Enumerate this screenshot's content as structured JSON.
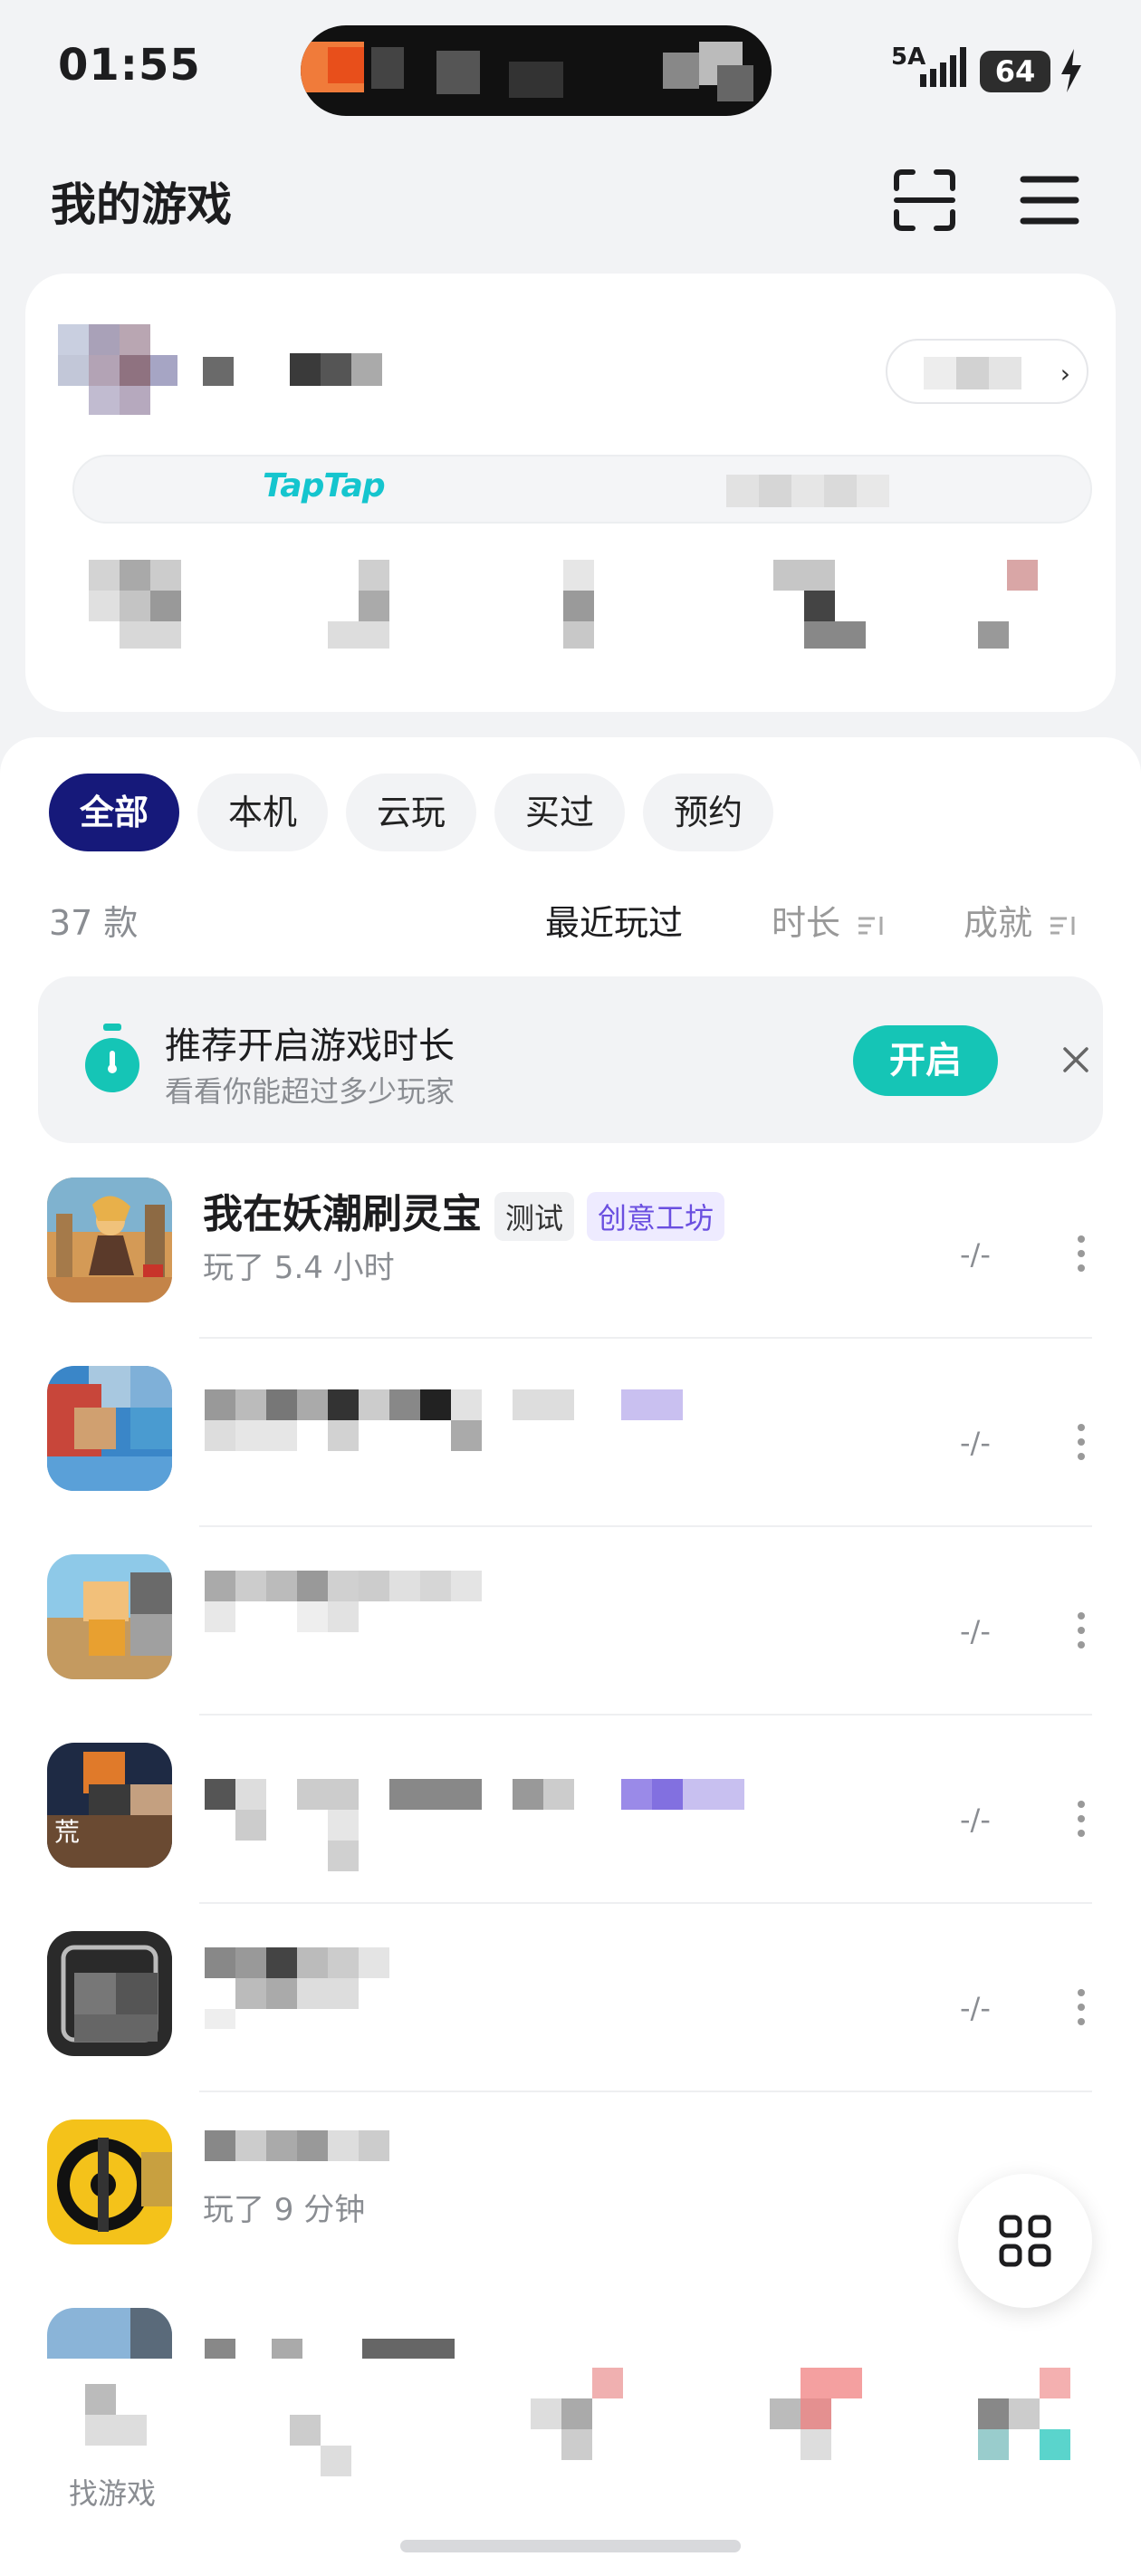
{
  "status_bar": {
    "time": "01:55",
    "signal_label": "5A",
    "battery": "64"
  },
  "header": {
    "title": "我的游戏",
    "scan_icon": "scan-icon",
    "menu_icon": "menu-icon"
  },
  "profile": {
    "platform_logo": "TapTap"
  },
  "tabs": [
    {
      "label": "全部",
      "active": true
    },
    {
      "label": "本机",
      "active": false
    },
    {
      "label": "云玩",
      "active": false
    },
    {
      "label": "买过",
      "active": false
    },
    {
      "label": "预约",
      "active": false
    }
  ],
  "list_header": {
    "count": "37 款",
    "sort_recent": "最近玩过",
    "sort_duration": "时长",
    "sort_achievement": "成就"
  },
  "promo": {
    "title": "推荐开启游戏时长",
    "subtitle": "看看你能超过多少玩家",
    "button": "开启"
  },
  "games": [
    {
      "name": "我在妖潮刷灵宝",
      "tag_test": "测试",
      "tag_workshop": "创意工坊",
      "playtime": "玩了 5.4 小时",
      "score": "-/-"
    },
    {
      "name": "",
      "playtime": "",
      "score": "-/-"
    },
    {
      "name": "",
      "playtime": "",
      "score": "-/-"
    },
    {
      "name": "",
      "playtime": "",
      "score": "-/-"
    },
    {
      "name": "",
      "playtime": "",
      "score": "-/-"
    },
    {
      "name": "",
      "playtime": "玩了 9 分钟",
      "score": ""
    }
  ],
  "bottom_nav": {
    "find_games": "找游戏"
  },
  "colors": {
    "active_tab": "#16197a",
    "accent": "#15c5b6",
    "workshop_tag": "#6a4fe0"
  }
}
